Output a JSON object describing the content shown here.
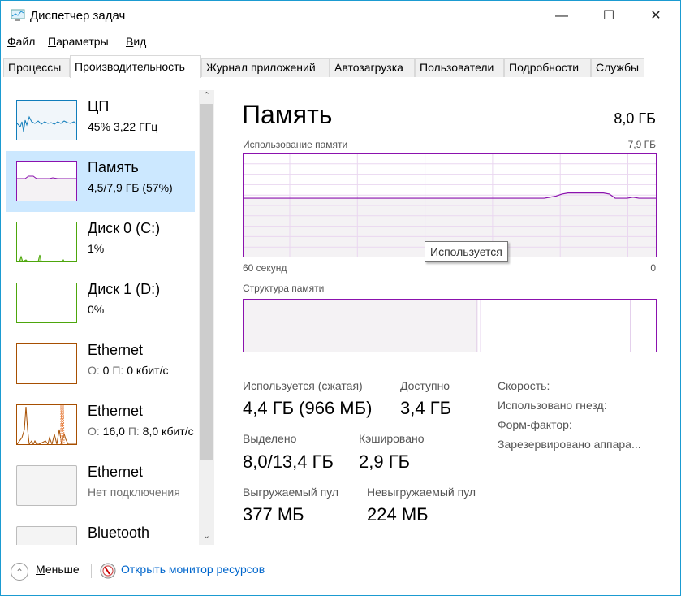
{
  "window": {
    "title": "Диспетчер задач",
    "icon": "task-manager-icon",
    "controls": [
      "minimize",
      "maximize",
      "close"
    ]
  },
  "menu": [
    {
      "label": "Файл",
      "accel": "Ф",
      "rest": "айл"
    },
    {
      "label": "Параметры",
      "accel": "П",
      "rest": "араметры"
    },
    {
      "label": "Вид",
      "accel": "В",
      "rest": "ид"
    }
  ],
  "tabs": [
    {
      "label": "Процессы"
    },
    {
      "label": "Производительность",
      "active": true
    },
    {
      "label": "Журнал приложений"
    },
    {
      "label": "Автозагрузка"
    },
    {
      "label": "Пользователи"
    },
    {
      "label": "Подробности"
    },
    {
      "label": "Службы"
    }
  ],
  "sidebar": {
    "items": [
      {
        "name": "ЦП",
        "sub": "45% 3,22 ГГц",
        "color": "#117dbb"
      },
      {
        "name": "Память",
        "sub": "4,5/7,9 ГБ (57%)",
        "color": "#8b12ae",
        "selected": true
      },
      {
        "name": "Диск 0 (C:)",
        "sub": "1%",
        "color": "#4da60c"
      },
      {
        "name": "Диск 1 (D:)",
        "sub": "0%",
        "color": "#4da60c"
      },
      {
        "name": "Ethernet",
        "sub_o": "О:",
        "sub_o_val": "0",
        "sub_p": "П:",
        "sub_p_val": "0 кбит/с",
        "color": "#a74f01"
      },
      {
        "name": "Ethernet",
        "sub_o": "О:",
        "sub_o_val": "16,0",
        "sub_p": "П:",
        "sub_p_val": "8,0 кбит/с",
        "color": "#a74f01"
      },
      {
        "name": "Ethernet",
        "sub": "Нет подключения",
        "color": "#bcbcbc"
      },
      {
        "name": "Bluetooth",
        "sub": "",
        "color": "#bcbcbc"
      }
    ]
  },
  "main": {
    "title": "Память",
    "total": "8,0 ГБ",
    "usage_label": "Использование памяти",
    "usage_max": "7,9 ГБ",
    "time_left": "60 секунд",
    "time_right": "0",
    "tooltip": "Используется",
    "structure_label": "Структура памяти",
    "stats": {
      "in_use_label": "Используется (сжатая)",
      "in_use": "4,4 ГБ (966 МБ)",
      "available_label": "Доступно",
      "available": "3,4 ГБ",
      "committed_label": "Выделено",
      "committed": "8,0/13,4 ГБ",
      "cached_label": "Кэшировано",
      "cached": "2,9 ГБ",
      "paged_label": "Выгружаемый пул",
      "paged": "377 МБ",
      "nonpaged_label": "Невыгружаемый пул",
      "nonpaged": "224 МБ",
      "speed_label": "Скорость:",
      "slots_label": "Использовано гнезд:",
      "form_label": "Форм-фактор:",
      "reserved_label": "Зарезервировано аппара..."
    }
  },
  "chart_data": {
    "type": "area",
    "xlabel_left": "60 секунд",
    "xlabel_right": "0",
    "ymax": "7,9 ГБ",
    "grid": true,
    "color": "#8b12ae",
    "usage_percent": [
      57,
      57,
      57,
      57,
      57,
      57,
      57,
      57,
      57,
      57,
      57,
      57,
      57,
      57,
      57,
      57,
      57,
      57,
      57,
      57,
      57,
      57,
      57,
      57,
      57,
      57,
      57,
      57,
      57,
      57,
      57,
      57,
      57,
      57,
      57,
      57,
      57,
      57,
      57,
      57,
      57,
      57,
      57,
      57,
      57,
      57,
      57,
      57,
      57,
      57,
      57,
      57,
      58,
      59,
      61,
      62,
      62,
      62,
      62,
      62,
      62,
      62,
      61,
      57,
      57,
      57,
      58,
      57,
      57,
      57,
      57
    ]
  },
  "structure": {
    "in_use_fraction": 0.567,
    "modified_fraction": 0.008,
    "standby_fraction": 0.362,
    "free_fraction": 0.063
  },
  "footer": {
    "less": "Меньше",
    "less_accel": "М",
    "less_rest": "еньше",
    "monitor": "Открыть монитор ресурсов"
  }
}
